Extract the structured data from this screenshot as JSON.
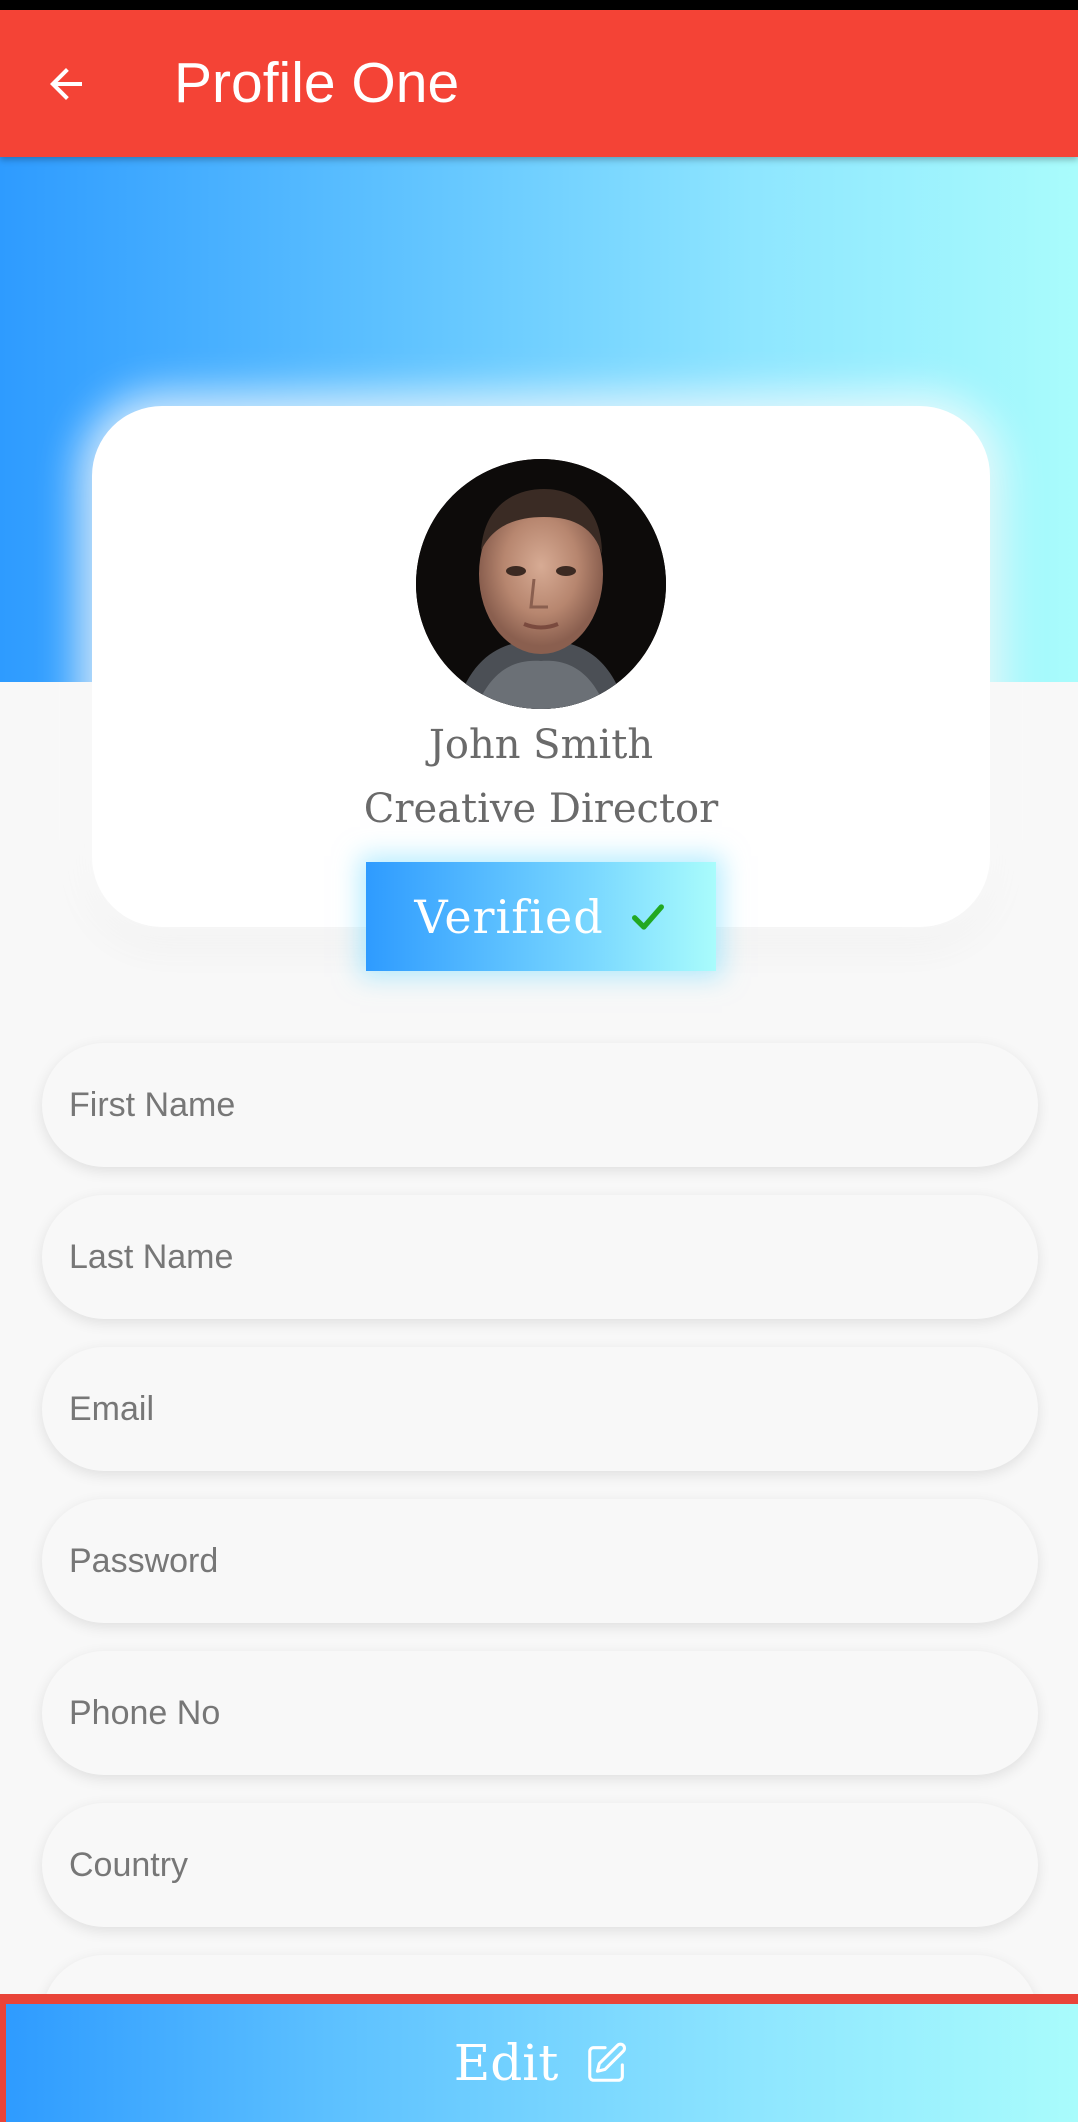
{
  "app_bar": {
    "title": "Profile One",
    "back_icon": "arrow-back-icon",
    "color": "#f44336"
  },
  "profile": {
    "name": "John Smith",
    "role": "Creative Director",
    "avatar": "profile-photo"
  },
  "badge": {
    "label": "Verified",
    "icon": "check-icon",
    "icon_color": "#22a822"
  },
  "form": {
    "fields": [
      {
        "placeholder": "First Name",
        "value": ""
      },
      {
        "placeholder": "Last Name",
        "value": ""
      },
      {
        "placeholder": "Email",
        "value": ""
      },
      {
        "placeholder": "Password",
        "value": ""
      },
      {
        "placeholder": "Phone No",
        "value": ""
      },
      {
        "placeholder": "Country",
        "value": ""
      }
    ]
  },
  "footer": {
    "edit_label": "Edit",
    "edit_icon": "edit-pencil-icon"
  },
  "colors": {
    "gradient_start": "#2e9bff",
    "gradient_end": "#a9fcfc",
    "background": "#f8f8f8"
  }
}
